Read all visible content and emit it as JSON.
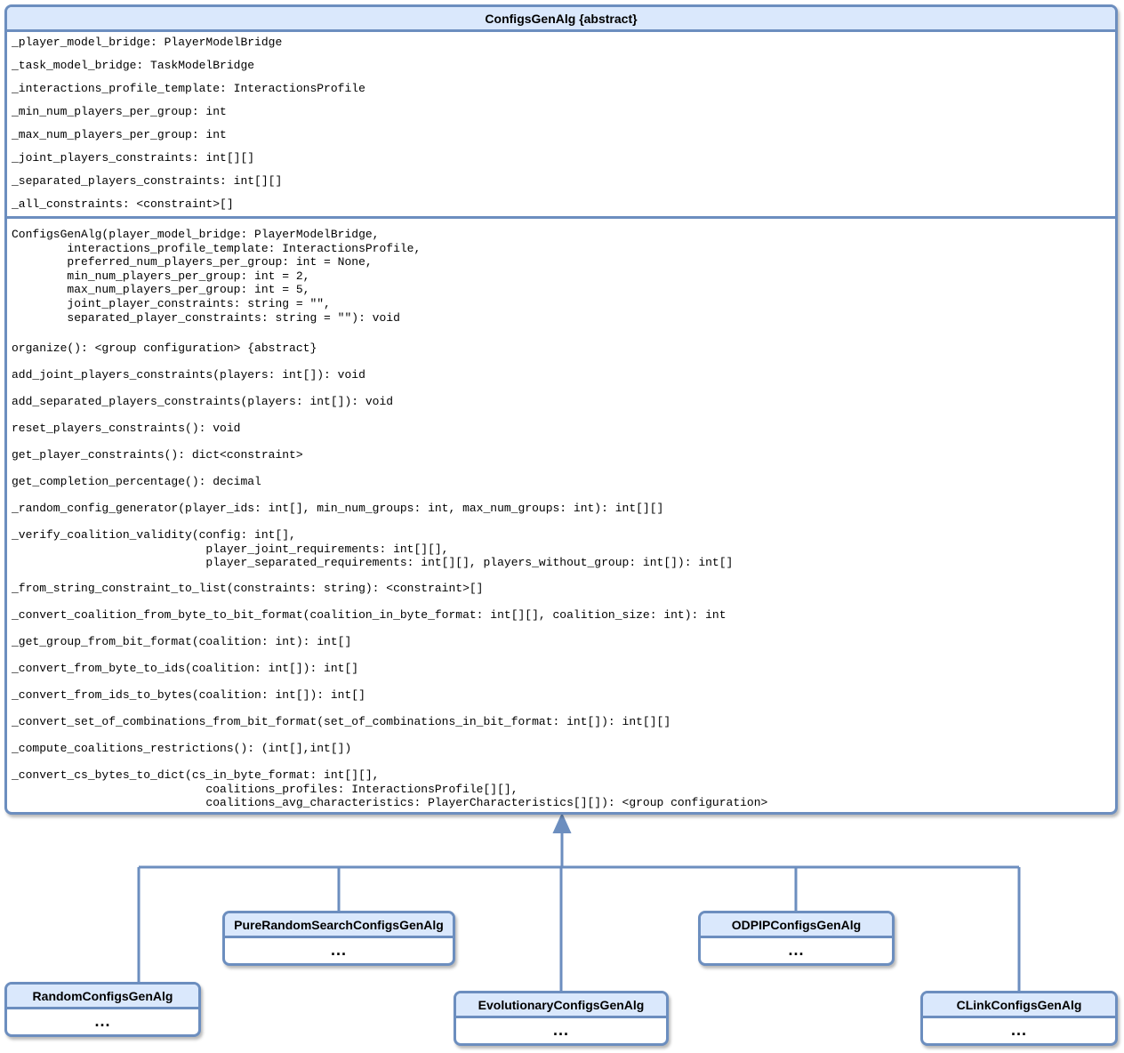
{
  "base_class": {
    "name": "ConfigsGenAlg {abstract}",
    "attributes": [
      "_player_model_bridge: PlayerModelBridge",
      "_task_model_bridge: TaskModelBridge",
      "_interactions_profile_template: InteractionsProfile",
      "_min_num_players_per_group: int",
      "_max_num_players_per_group: int",
      "_joint_players_constraints: int[][]",
      "_separated_players_constraints: int[][]",
      "_all_constraints: <constraint>[]"
    ],
    "methods": [
      "ConfigsGenAlg(player_model_bridge: PlayerModelBridge,\n        interactions_profile_template: InteractionsProfile,\n        preferred_num_players_per_group: int = None,\n        min_num_players_per_group: int = 2,\n        max_num_players_per_group: int = 5,\n        joint_player_constraints: string = \"\",\n        separated_player_constraints: string = \"\"): void",
      "organize(): <group configuration> {abstract}",
      "add_joint_players_constraints(players: int[]): void",
      "add_separated_players_constraints(players: int[]): void",
      "reset_players_constraints(): void",
      "get_player_constraints(): dict<constraint>",
      "get_completion_percentage(): decimal",
      "_random_config_generator(player_ids: int[], min_num_groups: int, max_num_groups: int): int[][]",
      "_verify_coalition_validity(config: int[],\n                            player_joint_requirements: int[][],\n                            player_separated_requirements: int[][], players_without_group: int[]): int[]",
      "_from_string_constraint_to_list(constraints: string): <constraint>[]",
      "_convert_coalition_from_byte_to_bit_format(coalition_in_byte_format: int[][], coalition_size: int): int",
      "_get_group_from_bit_format(coalition: int): int[]",
      "_convert_from_byte_to_ids(coalition: int[]): int[]",
      "_convert_from_ids_to_bytes(coalition: int[]): int[]",
      "_convert_set_of_combinations_from_bit_format(set_of_combinations_in_bit_format: int[]): int[][]",
      "_compute_coalitions_restrictions(): (int[],int[])",
      "_convert_cs_bytes_to_dict(cs_in_byte_format: int[][],\n                            coalitions_profiles: InteractionsProfile[][],\n                            coalitions_avg_characteristics: PlayerCharacteristics[][]): <group configuration>"
    ]
  },
  "subclasses": [
    {
      "name": "RandomConfigsGenAlg",
      "body": "..."
    },
    {
      "name": "PureRandomSearchConfigsGenAlg",
      "body": "..."
    },
    {
      "name": "EvolutionaryConfigsGenAlg",
      "body": "..."
    },
    {
      "name": "ODPIPConfigsGenAlg",
      "body": "..."
    },
    {
      "name": "CLinkConfigsGenAlg",
      "body": "..."
    }
  ],
  "colors": {
    "border": "#6c8ebf",
    "header_fill": "#dae8fc"
  }
}
